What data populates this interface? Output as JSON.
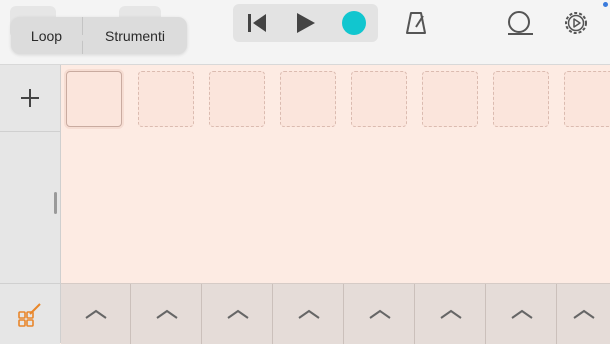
{
  "toolbar": {
    "tabs_popover": {
      "loop_label": "Loop",
      "instruments_label": "Strumenti"
    },
    "transport": {
      "rewind_icon": "skip-to-start-icon",
      "play_icon": "play-icon",
      "record_icon": "record-icon",
      "record_color": "#11c6cf"
    },
    "metronome_icon": "metronome-icon",
    "loop_browser_icon": "loop-browser-icon",
    "settings_icon": "gear-icon"
  },
  "sidebar": {
    "add_icon": "plus-icon",
    "view_toggle_icon": "grid-pencil-icon"
  },
  "grid": {
    "cell_count": 8,
    "selected_cell_index": 0
  },
  "bottom_controls": {
    "column_count": 8,
    "column_icon": "chevron-up-icon"
  },
  "colors": {
    "accent": "#11c6cf",
    "grid_background": "#fdebe3",
    "orange_icon": "#e9862a"
  }
}
